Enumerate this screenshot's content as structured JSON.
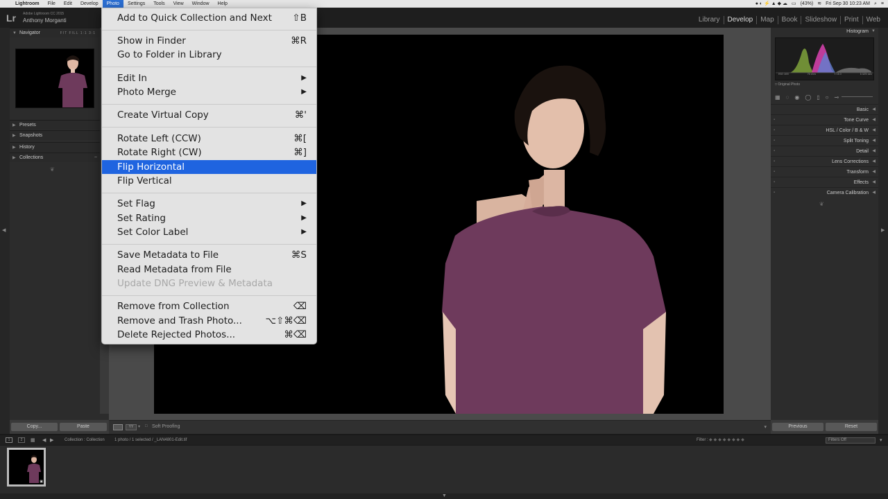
{
  "mac_menubar": {
    "app": "Lightroom",
    "items": [
      "File",
      "Edit",
      "Develop",
      "Photo",
      "Settings",
      "Tools",
      "View",
      "Window",
      "Help"
    ],
    "active": "Photo",
    "battery": "(43%)",
    "clock": "Fri Sep 30  10:23 AM"
  },
  "lr_header": {
    "logo": "Lr",
    "version": "Adobe Lightroom CC 2015",
    "user": "Anthony Morganti",
    "modules": [
      "Library",
      "Develop",
      "Map",
      "Book",
      "Slideshow",
      "Print",
      "Web"
    ],
    "active_module": "Develop"
  },
  "left_panel": {
    "navigator": "Navigator",
    "nav_options": [
      "FIT",
      "FILL",
      "1:1",
      "3:1"
    ],
    "sections": [
      "Presets",
      "Snapshots",
      "History",
      "Collections"
    ],
    "copy_button": "Copy...",
    "paste_button": "Paste"
  },
  "right_panel": {
    "histogram": "Histogram",
    "hist_info": [
      "ISO 100",
      "70 mm",
      "f / 8.0",
      "1/125 sec"
    ],
    "original_photo": "Original Photo",
    "sections": [
      "Basic",
      "Tone Curve",
      "HSL  /  Color  /  B & W",
      "Split Toning",
      "Detail",
      "Lens Corrections",
      "Transform",
      "Effects",
      "Camera Calibration"
    ],
    "previous_button": "Previous",
    "reset_button": "Reset"
  },
  "toolbar": {
    "soft_proofing": "Soft Proofing"
  },
  "filmstrip_bar": {
    "source": "Collection : Collection",
    "count": "1 photo / 1 selected / _LAN4801-Edit.tif",
    "filter_label": "Filter :",
    "filter_value": "Filters Off"
  },
  "photo_menu": {
    "items": [
      {
        "label": "Add to Quick Collection and Next",
        "shortcut": "⇧B"
      },
      {
        "label": "Show in Finder",
        "shortcut": "⌘R"
      },
      {
        "label": "Go to Folder in Library",
        "shortcut": ""
      },
      {
        "label": "Edit In",
        "submenu": "▶"
      },
      {
        "label": "Photo Merge",
        "submenu": "▶"
      },
      {
        "label": "Create Virtual Copy",
        "shortcut": "⌘'"
      },
      {
        "label": "Rotate Left (CCW)",
        "shortcut": "⌘["
      },
      {
        "label": "Rotate Right (CW)",
        "shortcut": "⌘]"
      },
      {
        "label": "Flip Horizontal",
        "shortcut": ""
      },
      {
        "label": "Flip Vertical",
        "shortcut": ""
      },
      {
        "label": "Set Flag",
        "submenu": "▶"
      },
      {
        "label": "Set Rating",
        "submenu": "▶"
      },
      {
        "label": "Set Color Label",
        "submenu": "▶"
      },
      {
        "label": "Save Metadata to File",
        "shortcut": "⌘S"
      },
      {
        "label": "Read Metadata from File",
        "shortcut": ""
      },
      {
        "label": "Update DNG Preview & Metadata",
        "shortcut": ""
      },
      {
        "label": "Remove from Collection",
        "shortcut": "⌫"
      },
      {
        "label": "Remove and Trash Photo...",
        "shortcut": "⌥⇧⌘⌫"
      },
      {
        "label": "Delete Rejected Photos...",
        "shortcut": "⌘⌫"
      }
    ],
    "highlighted": "Flip Horizontal",
    "disabled": "Update DNG Preview & Metadata"
  },
  "colors": {
    "menu_highlight": "#1f64e0",
    "shirt": "#6e3a5c",
    "panel_bg": "#2c2c2c"
  }
}
